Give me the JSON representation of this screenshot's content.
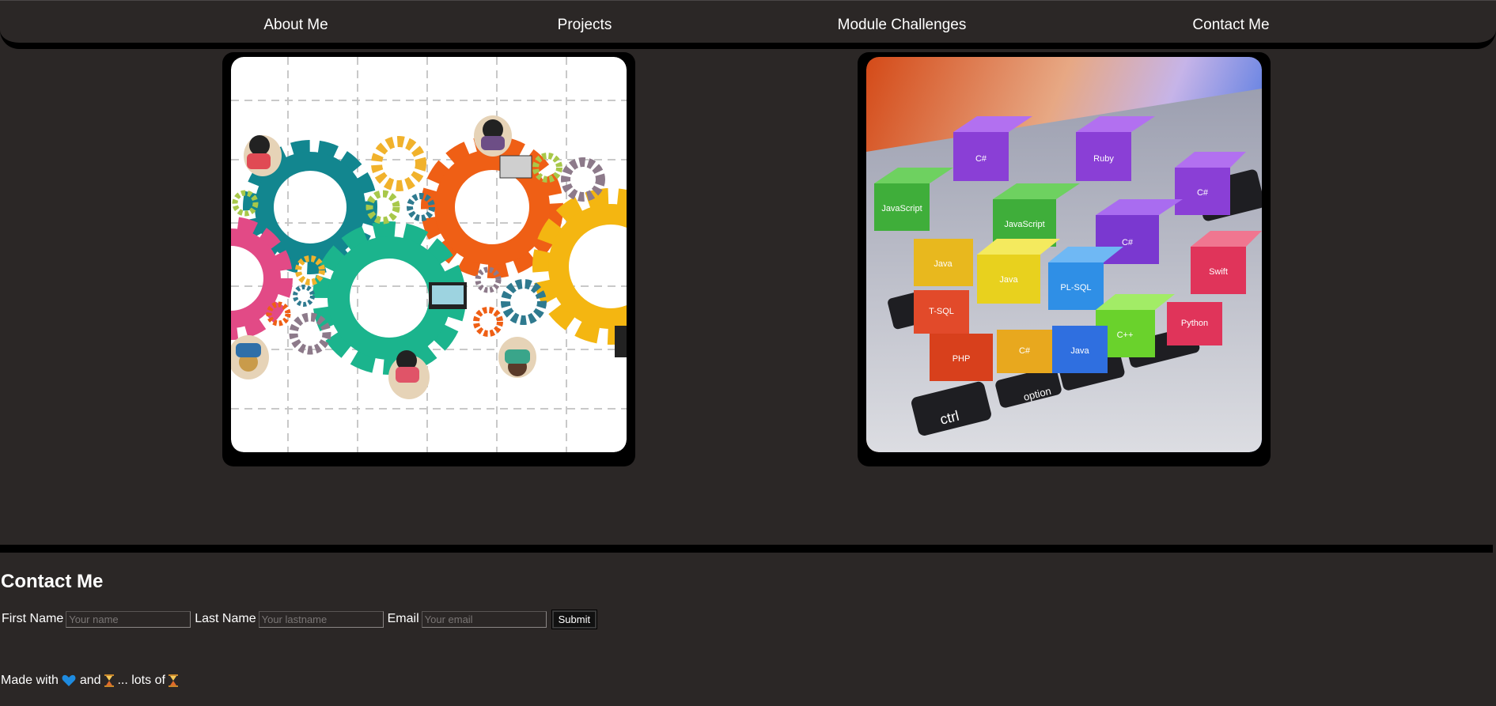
{
  "nav": {
    "items": [
      {
        "label": "About Me"
      },
      {
        "label": "Projects"
      },
      {
        "label": "Module Challenges"
      },
      {
        "label": "Contact Me"
      }
    ]
  },
  "projects": [
    {
      "image": "gears-teamwork-illustration"
    },
    {
      "image": "programming-language-cubes-on-keyboard",
      "cube_labels": [
        "C#",
        "Ruby",
        "JavaScript",
        "Java",
        "T-SQL",
        "Python",
        "PL-SQL",
        "C++",
        "PHP",
        "Swift",
        "C"
      ]
    }
  ],
  "contact": {
    "title": "Contact Me",
    "first_label": "First Name",
    "first_placeholder": "Your name",
    "last_label": "Last Name",
    "last_placeholder": "Your lastname",
    "email_label": "Email",
    "email_placeholder": "Your email",
    "submit_label": "Submit"
  },
  "footer": {
    "made_with": "Made with",
    "and": "and",
    "lots_of": "... lots of",
    "icons": [
      "blue-heart-icon",
      "hourglass-icon",
      "hourglass-icon"
    ]
  },
  "colors": {
    "background": "#2b2726",
    "border": "#000000",
    "text": "#ffffff"
  }
}
